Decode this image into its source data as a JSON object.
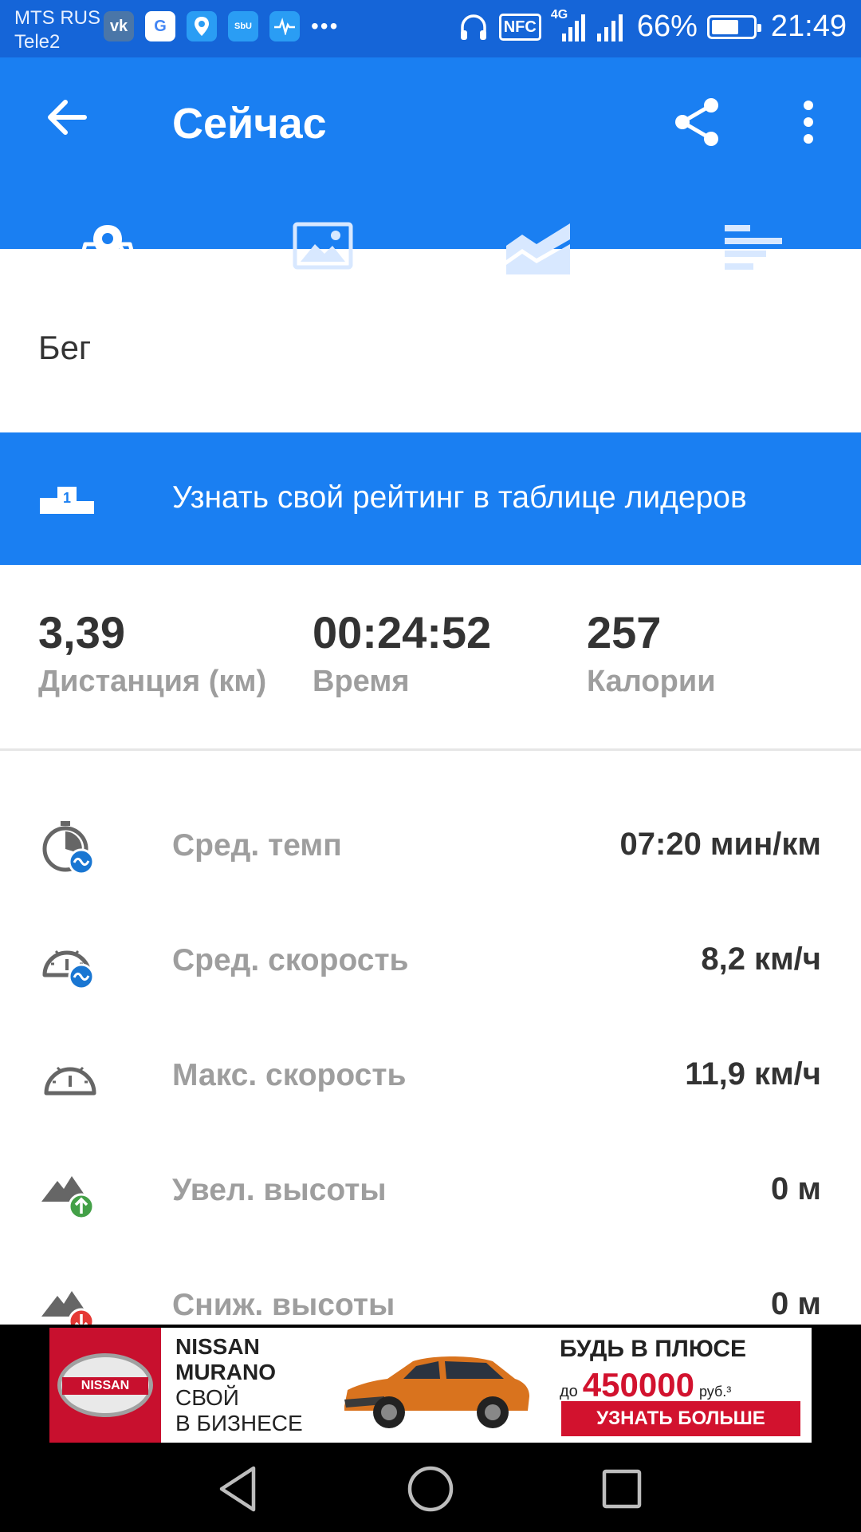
{
  "status_bar": {
    "carrier_1": "MTS RUS",
    "carrier_2": "Tele2",
    "network_type": "4G",
    "nfc_label": "NFC",
    "battery_percent": "66%",
    "battery_level": 0.66,
    "time": "21:49",
    "app_icons": [
      "vk-icon",
      "google-icon",
      "maps-icon",
      "sbol-icon",
      "health-icon"
    ]
  },
  "appbar": {
    "title": "Сейчас",
    "tabs": [
      "map-tab",
      "photos-tab",
      "charts-tab",
      "stats-tab"
    ],
    "selected_tab": 0
  },
  "activity": {
    "type": "Бег"
  },
  "leaderboard": {
    "text": "Узнать свой рейтинг в таблице лидеров",
    "rank": "1"
  },
  "summary": {
    "distance": {
      "value": "3,39",
      "label": "Дистанция (км)"
    },
    "time": {
      "value": "00:24:52",
      "label": "Время"
    },
    "calories": {
      "value": "257",
      "label": "Калории"
    }
  },
  "stats": [
    {
      "icon": "avg-pace-icon",
      "label": "Сред. темп",
      "value": "07:20 мин/км"
    },
    {
      "icon": "avg-speed-icon",
      "label": "Сред. скорость",
      "value": "8,2 км/ч"
    },
    {
      "icon": "max-speed-icon",
      "label": "Макс. скорость",
      "value": "11,9 км/ч"
    },
    {
      "icon": "elevation-gain-icon",
      "label": "Увел. высоты",
      "value": "0 м"
    },
    {
      "icon": "elevation-loss-icon",
      "label": "Сниж. высоты",
      "value": "0 м"
    }
  ],
  "ad": {
    "logo_text": "NISSAN",
    "brand_lines": [
      "NISSAN",
      "MURANO",
      "СВОЙ",
      "В БИЗНЕСЕ"
    ],
    "slogan": "БУДЬ В ПЛЮСЕ",
    "amount_prefix": "до",
    "amount": "450000",
    "amount_suffix": "руб.³",
    "cta": "УЗНАТЬ БОЛЬШЕ"
  },
  "colors": {
    "primary": "#1a7ff2",
    "status_bar": "#1565d8",
    "accent_blue": "#1976d2",
    "gain_green": "#43a047",
    "loss_red": "#e53935"
  }
}
